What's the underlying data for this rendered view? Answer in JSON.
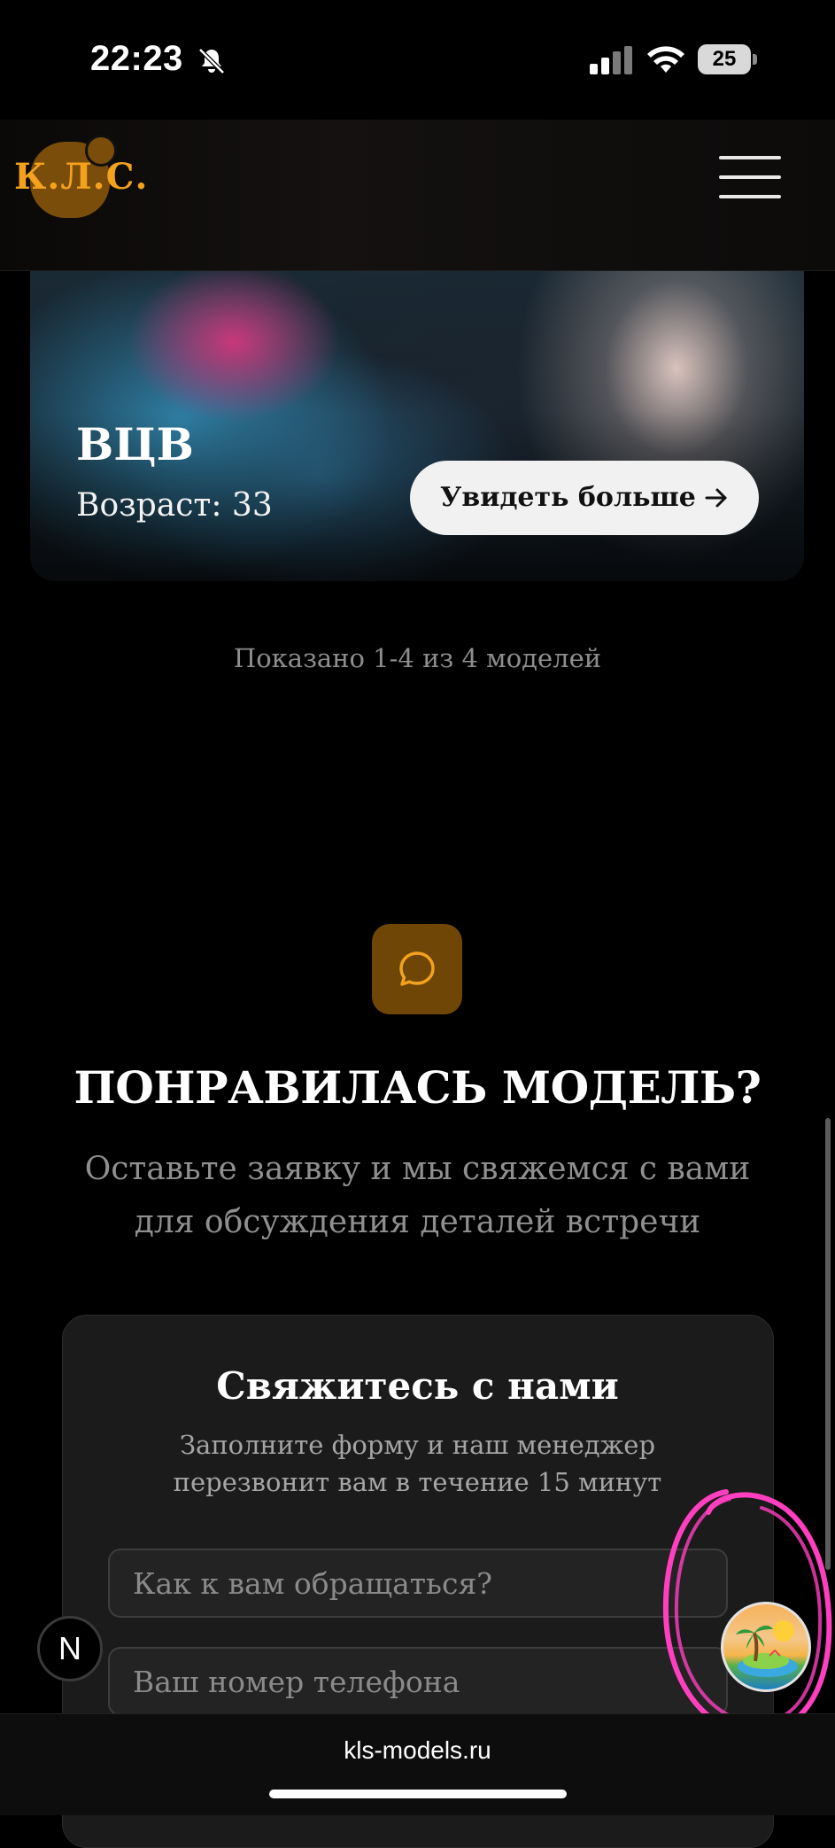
{
  "status_bar": {
    "time": "22:23",
    "battery": "25",
    "icons": [
      "bell-slash-icon",
      "signal-icon",
      "wifi-icon",
      "battery-icon"
    ]
  },
  "header": {
    "logo": "К.Л.С.",
    "menu_icon": "hamburger-menu-icon",
    "accent_color": "#f4a21d"
  },
  "model_card": {
    "name": "ВЦВ",
    "age": "Возраст: 33",
    "button_label": "Увидеть больше",
    "button_icon": "arrow-right-icon"
  },
  "pagination": "Показано 1-4 из 4 моделей",
  "cta": {
    "icon": "chat-bubble-icon",
    "title": "ПОНРАВИЛАСЬ МОДЕЛЬ?",
    "subtitle": "Оставьте заявку и мы свяжемся с вами для обсуждения деталей встречи"
  },
  "form": {
    "title": "Свяжитесь с нами",
    "subtitle": "Заполните форму и наш менеджер перезвонит вам в течение 15 минут",
    "name_placeholder": "Как к вам обращаться?",
    "name_value": "",
    "phone_placeholder": "Ваш номер телефона",
    "phone_value": ""
  },
  "floating": {
    "next_badge": "N",
    "palm_icon": "palm-island-icon"
  },
  "browser": {
    "url": "kls-models.ru"
  },
  "colors": {
    "background": "#000000",
    "accent": "#f4a21d",
    "accent_dark": "#6f4606",
    "annotation": "#ff3fbf"
  }
}
